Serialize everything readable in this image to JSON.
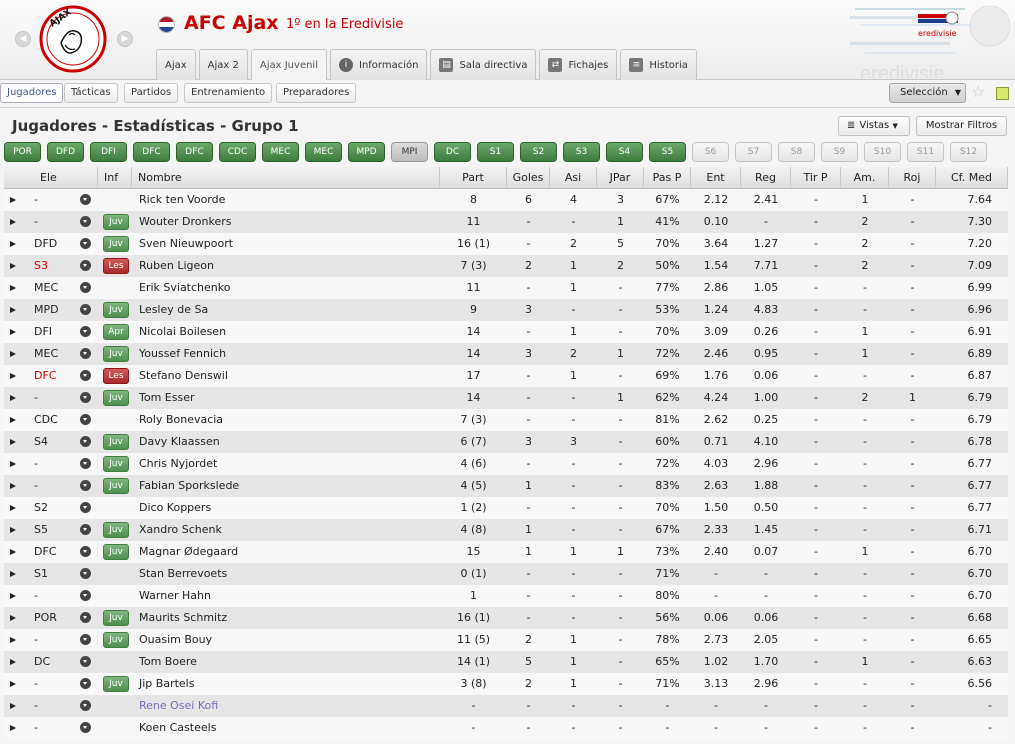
{
  "header": {
    "club_name": "AFC Ajax",
    "club_position": "1º en la Eredivisie",
    "league_logo_text": "eredivisie",
    "tabs": [
      {
        "label": "Ajax",
        "icon": ""
      },
      {
        "label": "Ajax 2",
        "icon": ""
      },
      {
        "label": "Ajax Juvenil",
        "icon": "",
        "active": true
      },
      {
        "label": "Información",
        "icon": "info-icon"
      },
      {
        "label": "Sala directiva",
        "icon": "boardroom-icon"
      },
      {
        "label": "Fichajes",
        "icon": "transfer-icon"
      },
      {
        "label": "Historia",
        "icon": "history-icon"
      }
    ]
  },
  "subnav": {
    "items": [
      "Jugadores",
      "Tácticas",
      "Partidos",
      "Entrenamiento",
      "Preparadores"
    ],
    "active": "Jugadores",
    "selection_label": "Selección"
  },
  "page": {
    "title": "Jugadores - Estadísticas - Grupo 1",
    "views_label": "Vistas",
    "filters_label": "Mostrar Filtros"
  },
  "position_filters": [
    {
      "label": "POR",
      "state": "on"
    },
    {
      "label": "DFD",
      "state": "on"
    },
    {
      "label": "DFI",
      "state": "on"
    },
    {
      "label": "DFC",
      "state": "on"
    },
    {
      "label": "DFC",
      "state": "on"
    },
    {
      "label": "CDC",
      "state": "on"
    },
    {
      "label": "MEC",
      "state": "on"
    },
    {
      "label": "MEC",
      "state": "on"
    },
    {
      "label": "MPD",
      "state": "on"
    },
    {
      "label": "MPI",
      "state": "mid"
    },
    {
      "label": "DC",
      "state": "on"
    },
    {
      "label": "S1",
      "state": "on"
    },
    {
      "label": "S2",
      "state": "on"
    },
    {
      "label": "S3",
      "state": "on"
    },
    {
      "label": "S4",
      "state": "on"
    },
    {
      "label": "S5",
      "state": "on"
    },
    {
      "label": "S6",
      "state": "off"
    },
    {
      "label": "S7",
      "state": "off"
    },
    {
      "label": "S8",
      "state": "off"
    },
    {
      "label": "S9",
      "state": "off"
    },
    {
      "label": "S10",
      "state": "off"
    },
    {
      "label": "S11",
      "state": "off"
    },
    {
      "label": "S12",
      "state": "off"
    }
  ],
  "table": {
    "columns": [
      "Ele",
      "Inf",
      "Nombre",
      "Part",
      "Goles",
      "Asi",
      "JPar",
      "Pas P",
      "Ent",
      "Reg",
      "Tir P",
      "Am.",
      "Roj",
      "Cf. Med"
    ],
    "rows": [
      {
        "ele": "-",
        "inf": "",
        "name": "Rick ten Voorde",
        "part": "8",
        "goles": "6",
        "asi": "4",
        "jpar": "3",
        "pasp": "67%",
        "ent": "2.12",
        "reg": "2.41",
        "tirp": "-",
        "am": "1",
        "roj": "-",
        "cf": "7.64"
      },
      {
        "ele": "-",
        "inf": "Juv",
        "name": "Wouter Dronkers",
        "part": "11",
        "goles": "-",
        "asi": "-",
        "jpar": "1",
        "pasp": "41%",
        "ent": "0.10",
        "reg": "-",
        "tirp": "-",
        "am": "2",
        "roj": "-",
        "cf": "7.30"
      },
      {
        "ele": "DFD",
        "inf": "Juv",
        "name": "Sven Nieuwpoort",
        "part": "16 (1)",
        "goles": "-",
        "asi": "2",
        "jpar": "5",
        "pasp": "70%",
        "ent": "3.64",
        "reg": "1.27",
        "tirp": "-",
        "am": "2",
        "roj": "-",
        "cf": "7.20"
      },
      {
        "ele": "S3",
        "eleRed": true,
        "inf": "Les",
        "name": "Ruben Ligeon",
        "part": "7 (3)",
        "goles": "2",
        "asi": "1",
        "jpar": "2",
        "pasp": "50%",
        "ent": "1.54",
        "reg": "7.71",
        "tirp": "-",
        "am": "2",
        "roj": "-",
        "cf": "7.09"
      },
      {
        "ele": "MEC",
        "inf": "",
        "name": "Erik Sviatchenko",
        "part": "11",
        "goles": "-",
        "asi": "1",
        "jpar": "-",
        "pasp": "77%",
        "ent": "2.86",
        "reg": "1.05",
        "tirp": "-",
        "am": "-",
        "roj": "-",
        "cf": "6.99"
      },
      {
        "ele": "MPD",
        "inf": "Juv",
        "name": "Lesley de Sa",
        "part": "9",
        "goles": "3",
        "asi": "-",
        "jpar": "-",
        "pasp": "53%",
        "ent": "1.24",
        "reg": "4.83",
        "tirp": "-",
        "am": "-",
        "roj": "-",
        "cf": "6.96"
      },
      {
        "ele": "DFI",
        "inf": "Apr",
        "name": "Nicolai Boilesen",
        "part": "14",
        "goles": "-",
        "asi": "1",
        "jpar": "-",
        "pasp": "70%",
        "ent": "3.09",
        "reg": "0.26",
        "tirp": "-",
        "am": "1",
        "roj": "-",
        "cf": "6.91"
      },
      {
        "ele": "MEC",
        "inf": "Juv",
        "name": "Youssef Fennich",
        "part": "14",
        "goles": "3",
        "asi": "2",
        "jpar": "1",
        "pasp": "72%",
        "ent": "2.46",
        "reg": "0.95",
        "tirp": "-",
        "am": "1",
        "roj": "-",
        "cf": "6.89"
      },
      {
        "ele": "DFC",
        "eleRed": true,
        "inf": "Les",
        "name": "Stefano Denswil",
        "part": "17",
        "goles": "-",
        "asi": "1",
        "jpar": "-",
        "pasp": "69%",
        "ent": "1.76",
        "reg": "0.06",
        "tirp": "-",
        "am": "-",
        "roj": "-",
        "cf": "6.87"
      },
      {
        "ele": "-",
        "inf": "Juv",
        "name": "Tom Esser",
        "part": "14",
        "goles": "-",
        "asi": "-",
        "jpar": "1",
        "pasp": "62%",
        "ent": "4.24",
        "reg": "1.00",
        "tirp": "-",
        "am": "2",
        "roj": "1",
        "cf": "6.79"
      },
      {
        "ele": "CDC",
        "inf": "",
        "name": "Roly Bonevacia",
        "part": "7 (3)",
        "goles": "-",
        "asi": "-",
        "jpar": "-",
        "pasp": "81%",
        "ent": "2.62",
        "reg": "0.25",
        "tirp": "-",
        "am": "-",
        "roj": "-",
        "cf": "6.79"
      },
      {
        "ele": "S4",
        "inf": "Juv",
        "name": "Davy Klaassen",
        "part": "6 (7)",
        "goles": "3",
        "asi": "3",
        "jpar": "-",
        "pasp": "60%",
        "ent": "0.71",
        "reg": "4.10",
        "tirp": "-",
        "am": "-",
        "roj": "-",
        "cf": "6.78"
      },
      {
        "ele": "-",
        "inf": "Juv",
        "name": "Chris Nyjordet",
        "part": "4 (6)",
        "goles": "-",
        "asi": "-",
        "jpar": "-",
        "pasp": "72%",
        "ent": "4.03",
        "reg": "2.96",
        "tirp": "-",
        "am": "-",
        "roj": "-",
        "cf": "6.77"
      },
      {
        "ele": "-",
        "inf": "Juv",
        "name": "Fabian Sporkslede",
        "part": "4 (5)",
        "goles": "1",
        "asi": "-",
        "jpar": "-",
        "pasp": "83%",
        "ent": "2.63",
        "reg": "1.88",
        "tirp": "-",
        "am": "-",
        "roj": "-",
        "cf": "6.77"
      },
      {
        "ele": "S2",
        "inf": "",
        "name": "Dico Koppers",
        "part": "1 (2)",
        "goles": "-",
        "asi": "-",
        "jpar": "-",
        "pasp": "70%",
        "ent": "1.50",
        "reg": "0.50",
        "tirp": "-",
        "am": "-",
        "roj": "-",
        "cf": "6.77"
      },
      {
        "ele": "S5",
        "inf": "Juv",
        "name": "Xandro Schenk",
        "part": "4 (8)",
        "goles": "1",
        "asi": "-",
        "jpar": "-",
        "pasp": "67%",
        "ent": "2.33",
        "reg": "1.45",
        "tirp": "-",
        "am": "-",
        "roj": "-",
        "cf": "6.71"
      },
      {
        "ele": "DFC",
        "inf": "Juv",
        "name": "Magnar Ødegaard",
        "part": "15",
        "goles": "1",
        "asi": "1",
        "jpar": "1",
        "pasp": "73%",
        "ent": "2.40",
        "reg": "0.07",
        "tirp": "-",
        "am": "1",
        "roj": "-",
        "cf": "6.70"
      },
      {
        "ele": "S1",
        "inf": "",
        "name": "Stan Berrevoets",
        "part": "0 (1)",
        "goles": "-",
        "asi": "-",
        "jpar": "-",
        "pasp": "71%",
        "ent": "-",
        "reg": "-",
        "tirp": "-",
        "am": "-",
        "roj": "-",
        "cf": "6.70"
      },
      {
        "ele": "-",
        "inf": "",
        "name": "Warner Hahn",
        "part": "1",
        "goles": "-",
        "asi": "-",
        "jpar": "-",
        "pasp": "80%",
        "ent": "-",
        "reg": "-",
        "tirp": "-",
        "am": "-",
        "roj": "-",
        "cf": "6.70"
      },
      {
        "ele": "POR",
        "inf": "Juv",
        "name": "Maurits Schmitz",
        "part": "16 (1)",
        "goles": "-",
        "asi": "-",
        "jpar": "-",
        "pasp": "56%",
        "ent": "0.06",
        "reg": "0.06",
        "tirp": "-",
        "am": "-",
        "roj": "-",
        "cf": "6.68"
      },
      {
        "ele": "-",
        "inf": "Juv",
        "name": "Ouasim Bouy",
        "part": "11 (5)",
        "goles": "2",
        "asi": "1",
        "jpar": "-",
        "pasp": "78%",
        "ent": "2.73",
        "reg": "2.05",
        "tirp": "-",
        "am": "-",
        "roj": "-",
        "cf": "6.65"
      },
      {
        "ele": "DC",
        "inf": "",
        "name": "Tom Boere",
        "part": "14 (1)",
        "goles": "5",
        "asi": "1",
        "jpar": "-",
        "pasp": "65%",
        "ent": "1.02",
        "reg": "1.70",
        "tirp": "-",
        "am": "1",
        "roj": "-",
        "cf": "6.63"
      },
      {
        "ele": "-",
        "inf": "Juv",
        "name": "Jip Bartels",
        "part": "3 (8)",
        "goles": "2",
        "asi": "1",
        "jpar": "-",
        "pasp": "71%",
        "ent": "3.13",
        "reg": "2.96",
        "tirp": "-",
        "am": "-",
        "roj": "-",
        "cf": "6.56"
      },
      {
        "ele": "-",
        "inf": "",
        "name": "Rene Osei Kofi",
        "nameLink": true,
        "part": "-",
        "goles": "-",
        "asi": "-",
        "jpar": "-",
        "pasp": "-",
        "ent": "-",
        "reg": "-",
        "tirp": "-",
        "am": "-",
        "roj": "-",
        "cf": "-"
      },
      {
        "ele": "-",
        "inf": "",
        "name": "Koen Casteels",
        "part": "-",
        "goles": "-",
        "asi": "-",
        "jpar": "-",
        "pasp": "-",
        "ent": "-",
        "reg": "-",
        "tirp": "-",
        "am": "-",
        "roj": "-",
        "cf": "-"
      }
    ]
  },
  "colors": {
    "accent": "#cc0000",
    "filter_on": "#4f8f4f",
    "injured": "#a82a2a",
    "link": "#7a6ab8"
  }
}
